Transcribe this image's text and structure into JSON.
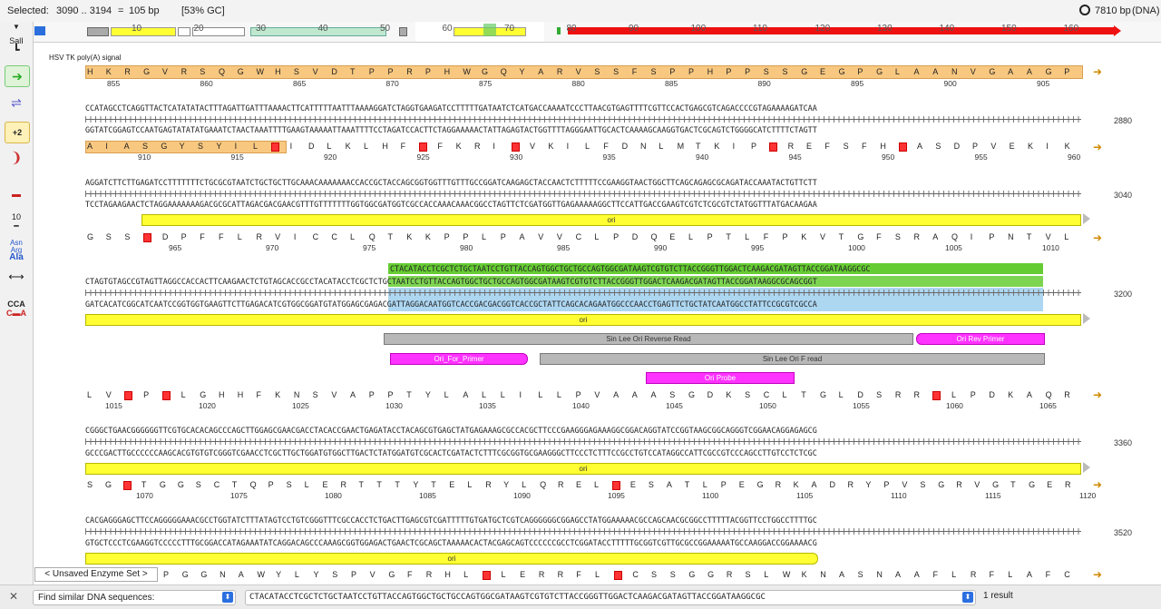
{
  "status": {
    "selected_label": "Selected:",
    "range": "3090 .. 3194",
    "eq": "=",
    "length": "105 bp",
    "gc": "[53% GC]",
    "total": "7810 bp",
    "type": "(DNA)"
  },
  "map": {
    "ticks": [
      "10",
      "20",
      "30",
      "40",
      "50",
      "60",
      "70",
      "80",
      "90",
      "100",
      "110",
      "120",
      "130",
      "140",
      "150",
      "160"
    ]
  },
  "toolbar": {
    "enzyme_label": "SalI",
    "frame_label": "+2",
    "ten_label": "10",
    "aa_labels": [
      "Asn",
      "Arg",
      "Ala"
    ],
    "cca_label": "CCA"
  },
  "feature_title": "HSV TK poly(A) signal",
  "row1": {
    "aa": "H K R G V R S Q G W H S V D T P P R P H W G Q Y A R V S S F S P P H P P S S G E G P G L A A N V G A A G P",
    "nums": [
      "855",
      "860",
      "865",
      "870",
      "875",
      "880",
      "885",
      "890",
      "895",
      "900",
      "905"
    ]
  },
  "row2": {
    "top": "CCATAGCCTCAGGTTACTCATATATACTTTAGATTGATTTAAAACTTCATTTTTAATTTAAAAGGATCTAGGTGAAGATCCTTTTTGATAATCTCATGACCAAAATCCCTTAACGTGAGTTTTCGTTCCACTGAGCGTCAGACCCCGTAGAAAAGATCAA",
    "bottom": "GGTATCGGAGTCCAATGAGTATATATGAAATCTAACTAAATTTTGAAGTAAAAATTAAATTTTCCTAGATCCACTTCTAGGAAAAACTATTAGAGTACTGGTTTTAGGGAATTGCACTCAAAAGCAAGGTGACTCGCAGTCTGGGGCATCTTTTCTAGTT",
    "aa": "A I A S G Y S Y I L  I D L K L H F  F K R I  V K I L F D N L M T K I P  R E F S F H  A S D P V E K I K",
    "nums": [
      "910",
      "915",
      "920",
      "925",
      "930",
      "935",
      "940",
      "945",
      "950",
      "955",
      "960"
    ],
    "rownum": "2880"
  },
  "row3": {
    "top": "AGGATCTTCTTGAGATCCTTTTTTTCTGCGCGTAATCTGCTGCTTGCAAACAAAAAAACCACCGCTACCAGCGGTGGTTTGTTTGCCGGATCAAGAGCTACCAACTCTTTTTCCGAAGGTAACTGGCTTCAGCAGAGCGCAGATACCAAATACTGTTCTT",
    "bottom": "TCCTAGAAGAACTCTAGGAAAAAAAGACGCGCATTAGACGACGAACGTTTGTTTTTTTGGTGGCGATGGTCGCCACCAAACAAACGGCCTAGTTCTCGATGGTTGAGAAAAAGGCTTCCATTGACCGAAGTCGTCTCGCGTCTATGGTTTATGACAAGAA",
    "feature": "ori",
    "aa": "G S S  D P F F L R V I C C L Q T K K P P L P A V V C L P D Q E L P T L F P K V T G F S R A Q I P N T V L",
    "nums": [
      "965",
      "970",
      "975",
      "980",
      "985",
      "990",
      "995",
      "1000",
      "1005",
      "1010"
    ],
    "rownum": "3040"
  },
  "row4": {
    "sel": "CTACATACCTCGCTCTGCTAATCCTGTTACCAGTGGCTGCTGCCAGTGGCGATAAGTCGTGTCTTACCGGGTTGGACTCAAGACGATAGTTACCGGATAAGGCGC",
    "top": "CTAGTGTAGCCGTAGTTAGGCCACCACTTCAAGAACTCTGTAGCACCGCCTACATACCTCGCTCTGCTAATCCTGTTACCAGTGGCTGCTGCCAGTGGCGATAAGTCGTGTCTTACCGGGTTGGACTCAAGACGATAGTTACCGGATAAGGCGCAGCGGT",
    "bottom": "GATCACATCGGCATCAATCCGGTGGTGAAGTTCTTGAGACATCGTGGCGGATGTATGGAGCGAGACGATTAGGACAATGGTCACCGACGACGGTCACCGCTATTCAGCACAGAATGGCCCAACCTGAGTTCTGCTATCAATGGCCTATTCCGCGTCGCCA",
    "feature": "ori",
    "primers": {
      "sin_lee_rev": "Sin Lee Ori Reverse Read",
      "ori_rev": "Ori Rev Primer",
      "ori_for": "Ori_For_Primer",
      "sin_lee_f": "Sin Lee Ori F read",
      "ori_probe": "Ori Probe"
    },
    "aa": "L V  P  L G H H F K N S V A P P T Y L A L L I L L P V A A A S G D K S C L T G L D S R R  L P D K A Q R",
    "nums": [
      "1015",
      "1020",
      "1025",
      "1030",
      "1035",
      "1040",
      "1045",
      "1050",
      "1055",
      "1060",
      "1065"
    ],
    "rownum": "3200"
  },
  "row5": {
    "top": "CGGGCTGAACGGGGGGTTCGTGCACACAGCCCAGCTTGGAGCGAACGACCTACACCGAACTGAGATACCTACAGCGTGAGCTATGAGAAAGCGCCACGCTTCCCGAAGGGAGAAAGGCGGACAGGTATCCGGTAAGCGGCAGGGTCGGAACAGGAGAGCG",
    "bottom": "GCCCGACTTGCCCCCCAAGCACGTGTGTCGGGTCGAACCTCGCTTGCTGGATGTGGCTTGACTCTATGGATGTCGCACTCGATACTCTTTCGCGGTGCGAAGGGCTTCCCTCTTTCCGCCTGTCCATAGGCCATTCGCCGTCCCAGCCTTGTCCTCTCGC",
    "feature": "ori",
    "aa": "S G  T G G S C T Q P S L E R T T T Y T E L R Y L Q R E L  E S A T L P E G R K A D R Y P V S G R V G T G E R",
    "nums": [
      "1070",
      "1075",
      "1080",
      "1085",
      "1090",
      "1095",
      "1100",
      "1105",
      "1110",
      "1115",
      "1120"
    ],
    "rownum": "3360"
  },
  "row6": {
    "top": "CACGAGGGAGCTTCCAGGGGGAAACGCCTGGTATCTTTATAGTCCTGTCGGGTTTCGCCACCTCTGACTTGAGCGTCGATTTTTGTGATGCTCGTCAGGGGGGCGGAGCCTATGGAAAAACGCCAGCAACGCGGCCTTTTTACGGTTCCTGGCCTTTTGC",
    "bottom": "GTGCTCCCTCGAAGGTCCCCCTTTGCGGACCATAGAAATATCAGGACAGCCCAAAGCGGTGGAGACTGAACTCGCAGCTAAAAACACTACGAGCAGTCCCCCCGCCTCGGATACCTTTTTGCGGTCGTTGCGCCGGAAAAATGCCAAGGACCGGAAAACG",
    "feature": "ori",
    "aa": "P G G N A W Y L Y S P V G F R H L  L E R R F L  C S S G G R S L W K N A S N A A F L R F L A F C",
    "rownum": "3520"
  },
  "enzyme_set": "< Unsaved Enzyme Set >",
  "bottom": {
    "find_label": "Find similar DNA sequences:",
    "query": "CTACATACCTCGCTCTGCTAATCCTGTTACCAGTGGCTGCTGCCAGTGGCGATAAGTCGTGTCTTACCGGGTTGGACTCAAGACGATAGTTACCGGATAAGGCGC",
    "result": "1 result"
  },
  "colors": {
    "accent": "#ffff33",
    "selection_green": "#66cc33",
    "selection_blue": "#99ccee",
    "stop": "#ff3333",
    "feature_orange": "#f8c880",
    "primer": "#ff33ff"
  }
}
